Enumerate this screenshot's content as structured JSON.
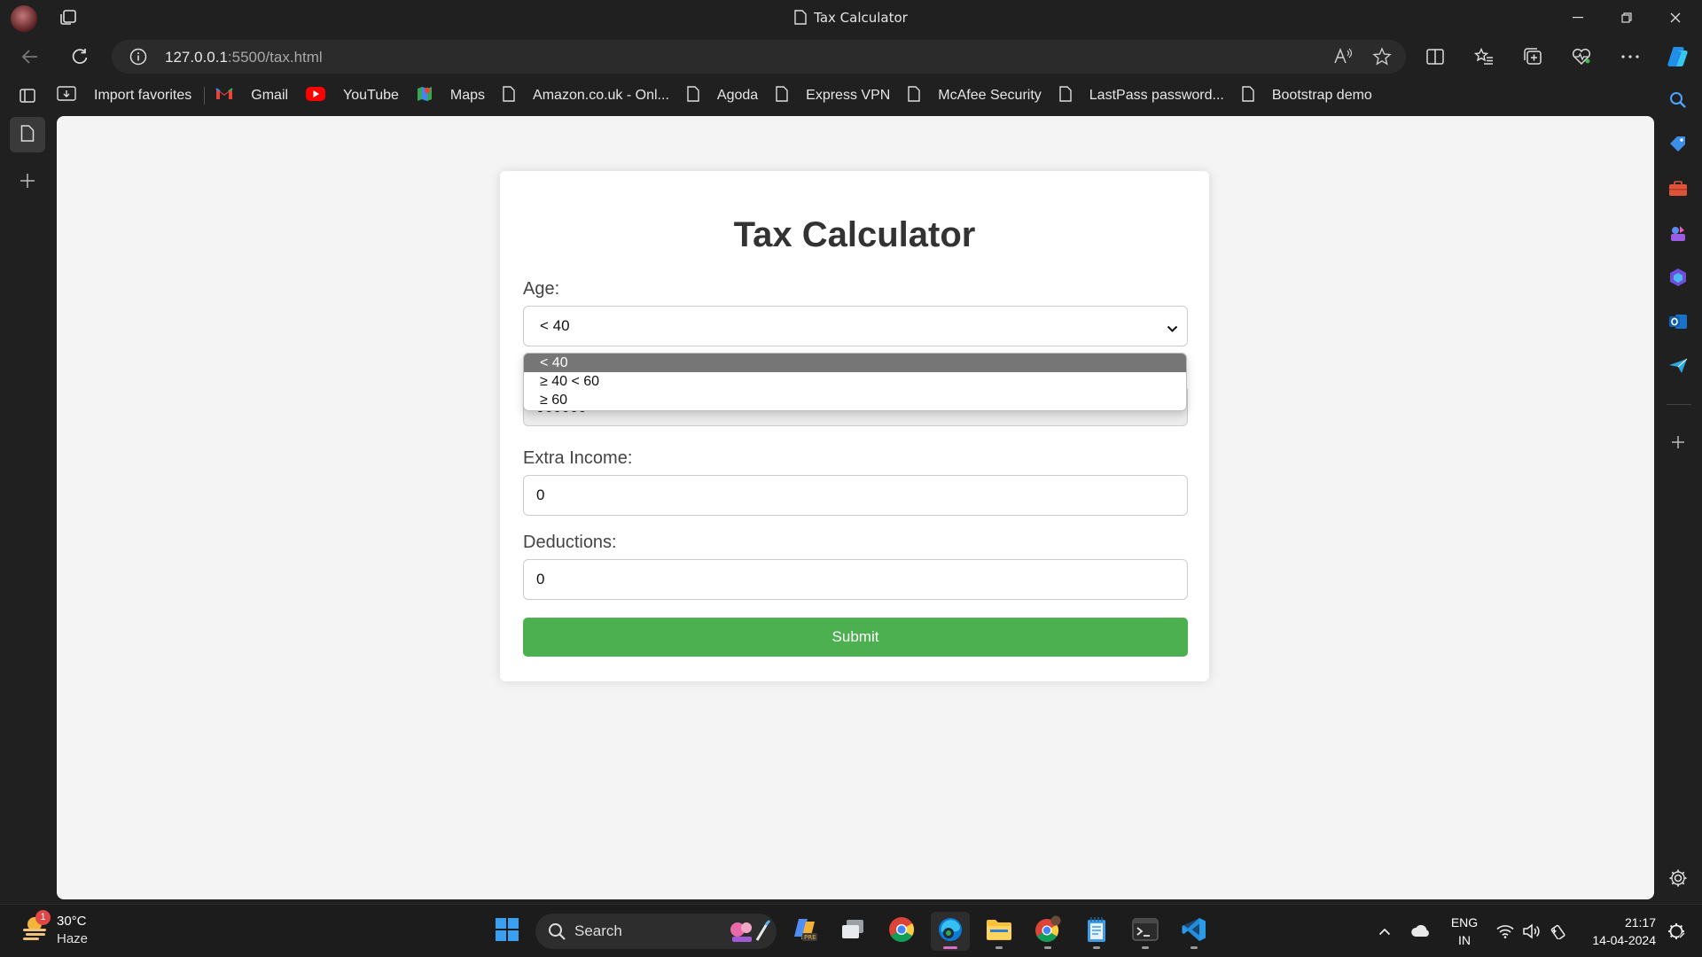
{
  "window": {
    "title": "Tax Calculator"
  },
  "address_bar": {
    "url_host": "127.0.0.1",
    "url_rest": ":5500/tax.html"
  },
  "favorites": [
    {
      "label": "Import favorites",
      "icon": "import-icon"
    },
    {
      "label": "Gmail",
      "icon": "gmail-icon"
    },
    {
      "label": "YouTube",
      "icon": "youtube-icon"
    },
    {
      "label": "Maps",
      "icon": "maps-icon"
    },
    {
      "label": "Amazon.co.uk - Onl...",
      "icon": "page-icon"
    },
    {
      "label": "Agoda",
      "icon": "page-icon"
    },
    {
      "label": "Express VPN",
      "icon": "page-icon"
    },
    {
      "label": "McAfee Security",
      "icon": "page-icon"
    },
    {
      "label": "LastPass password...",
      "icon": "page-icon"
    },
    {
      "label": "Bootstrap demo",
      "icon": "page-icon"
    }
  ],
  "page": {
    "heading": "Tax Calculator",
    "age_label": "Age:",
    "age_value": "< 40",
    "age_options": [
      "< 40",
      "≥ 40 < 60",
      "≥ 60"
    ],
    "income_value": "900000",
    "extra_income_label": "Extra Income:",
    "extra_income_value": "0",
    "deductions_label": "Deductions:",
    "deductions_value": "0",
    "submit_label": "Submit"
  },
  "taskbar": {
    "weather_temp": "30°C",
    "weather_cond": "Haze",
    "weather_badge": "1",
    "search_label": "Search",
    "lang_line1": "ENG",
    "lang_line2": "IN",
    "time": "21:17",
    "date": "14-04-2024"
  },
  "colors": {
    "accent_green": "#4caf50",
    "browser_chrome": "#202020",
    "page_bg": "#f4f4f4"
  }
}
